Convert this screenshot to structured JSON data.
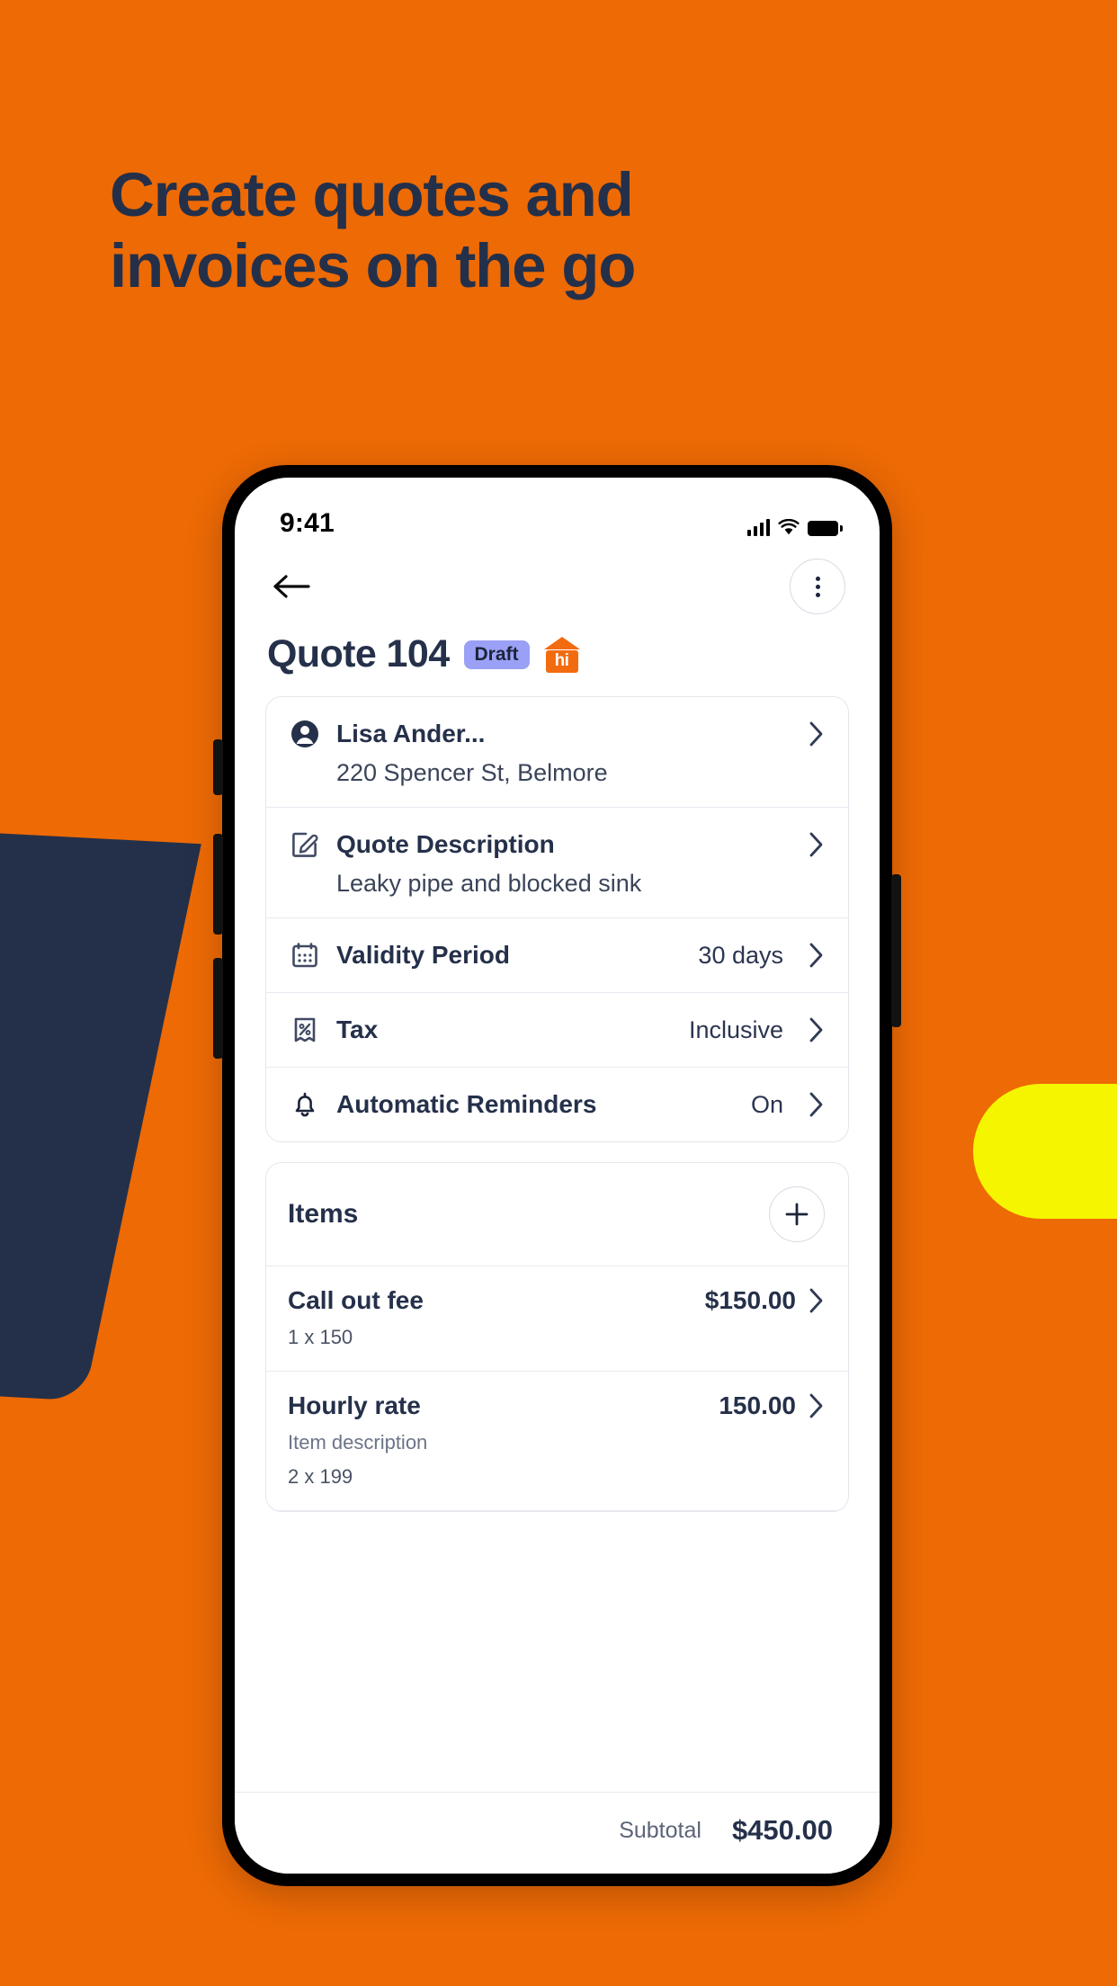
{
  "theme": {
    "background": "#ED6A05",
    "headline_color": "#24304A",
    "accent_navy": "#24304A",
    "accent_yellow": "#F5F500",
    "brand_orange": "#F26B0F",
    "badge_purple": "#9AA0F5"
  },
  "promo": {
    "headline_line1": "Create quotes and",
    "headline_line2": "invoices on the go"
  },
  "status_bar": {
    "time": "9:41",
    "signal_icon": "cellular-signal-icon",
    "wifi_icon": "wifi-icon",
    "battery_icon": "battery-full-icon"
  },
  "navbar": {
    "back_icon": "back-arrow-icon",
    "menu_icon": "kebab-menu-icon"
  },
  "header": {
    "title": "Quote 104",
    "badge": "Draft",
    "logo_text": "hi",
    "logo_icon": "house-logo-icon"
  },
  "details": {
    "rows": [
      {
        "icon": "person-icon",
        "label": "Lisa Ander...",
        "sub": "220 Spencer St, Belmore",
        "value": "",
        "chevron": true
      },
      {
        "icon": "edit-square-icon",
        "label": "Quote Description",
        "sub": "Leaky pipe and blocked sink",
        "value": "",
        "chevron": true
      },
      {
        "icon": "calendar-icon",
        "label": "Validity Period",
        "sub": "",
        "value": "30 days",
        "chevron": true
      },
      {
        "icon": "tax-receipt-icon",
        "label": "Tax",
        "sub": "",
        "value": "Inclusive",
        "chevron": true
      },
      {
        "icon": "bell-icon",
        "label": "Automatic Reminders",
        "sub": "",
        "value": "On",
        "chevron": true
      }
    ]
  },
  "items_section": {
    "title": "Items",
    "add_icon": "plus-icon",
    "items": [
      {
        "name": "Call out fee",
        "price": "$150.00",
        "description": "",
        "quantity": "1 x 150"
      },
      {
        "name": "Hourly rate",
        "price": "150.00",
        "description": "Item description",
        "quantity": "2 x 199"
      }
    ]
  },
  "footer": {
    "subtotal_label": "Subtotal",
    "subtotal_value": "$450.00"
  }
}
